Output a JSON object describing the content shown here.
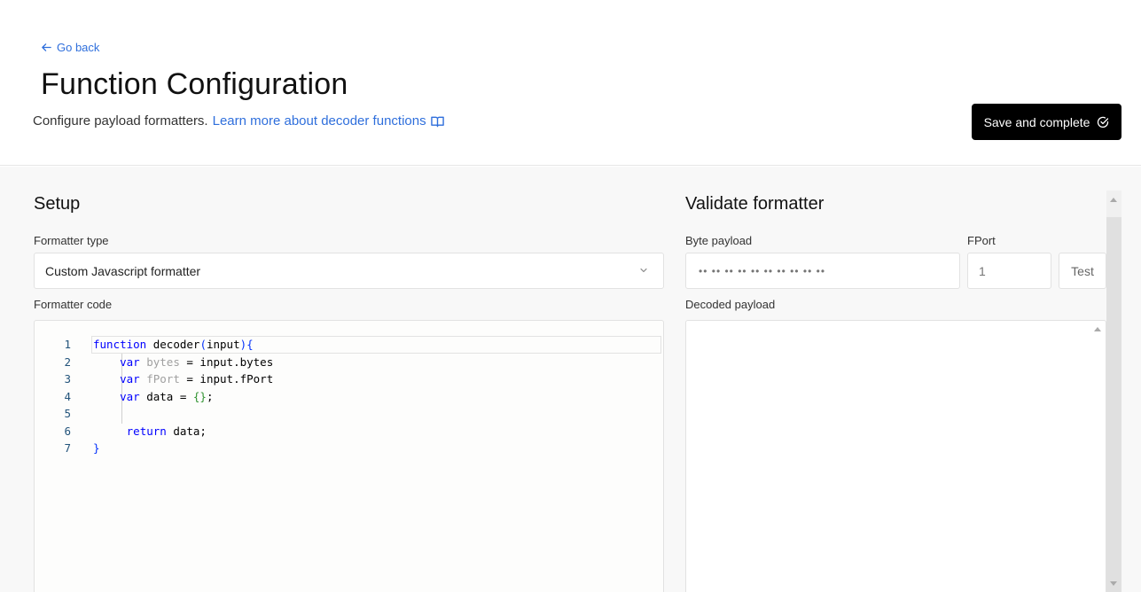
{
  "header": {
    "back_label": "Go back",
    "title": "Function Configuration",
    "subtitle": "Configure payload formatters.",
    "learn_more_link": "Learn more about decoder functions",
    "save_button": "Save and complete"
  },
  "setup": {
    "heading": "Setup",
    "formatter_type_label": "Formatter type",
    "formatter_type_value": "Custom Javascript formatter",
    "formatter_code_label": "Formatter code",
    "code_lines": [
      {
        "num": "1",
        "text": "function decoder(input){"
      },
      {
        "num": "2",
        "text": "    var bytes = input.bytes"
      },
      {
        "num": "3",
        "text": "    var fPort = input.fPort"
      },
      {
        "num": "4",
        "text": "    var data = {};"
      },
      {
        "num": "5",
        "text": ""
      },
      {
        "num": "6",
        "text": "     return data;"
      },
      {
        "num": "7",
        "text": "}"
      }
    ]
  },
  "validate": {
    "heading": "Validate formatter",
    "byte_payload_label": "Byte payload",
    "byte_payload_placeholder": "•• •• •• •• •• •• •• •• •• ••",
    "fport_label": "FPort",
    "fport_placeholder": "1",
    "test_button": "Test",
    "decoded_payload_label": "Decoded payload"
  },
  "colors": {
    "link": "#2f6fdc",
    "primary_button": "#000000",
    "keyword": "#0000ff"
  },
  "icons": {
    "back": "arrow-left-icon",
    "learn_more": "book-open-icon",
    "save": "check-circle-icon",
    "select": "chevron-down-icon"
  }
}
